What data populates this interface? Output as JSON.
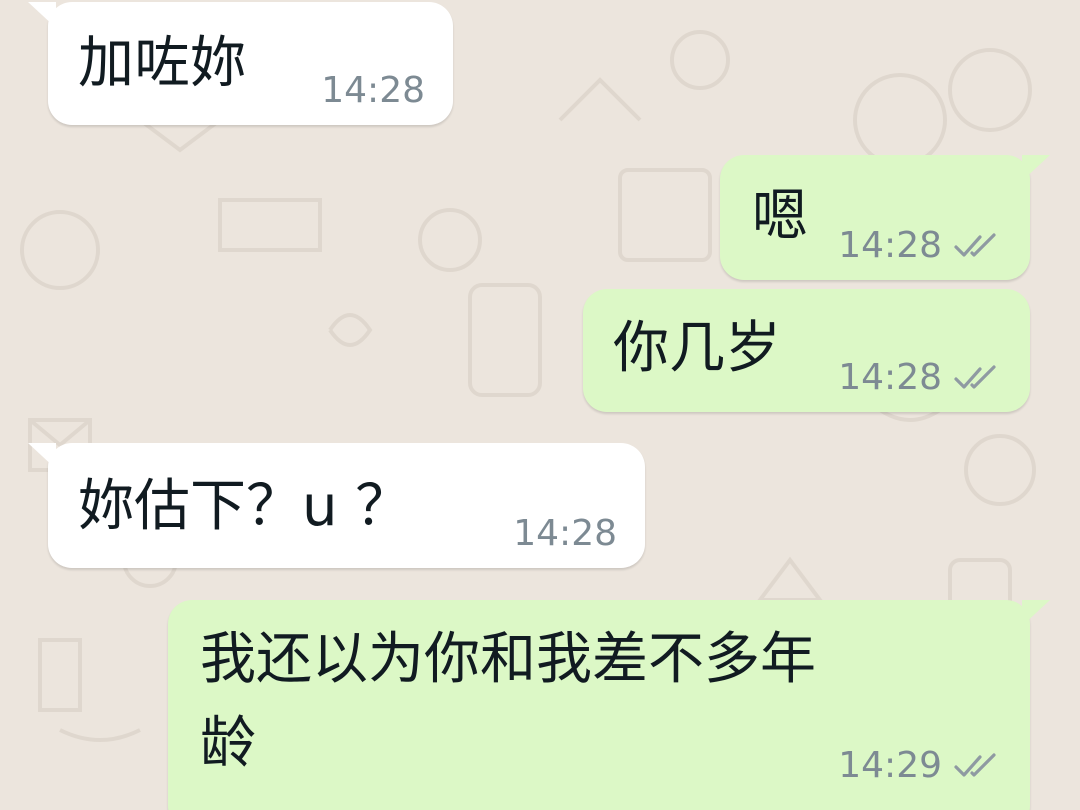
{
  "colors": {
    "wallpaper": "#ece5dd",
    "incoming_bubble": "#ffffff",
    "outgoing_bubble": "#dcf8c6",
    "timestamp": "#7d8a93",
    "read_ticks": "#8f9aa2"
  },
  "messages": [
    {
      "direction": "incoming",
      "text": "加咗妳",
      "time": "14:28"
    },
    {
      "direction": "outgoing",
      "text": "嗯",
      "time": "14:28",
      "status_icon": "double-check-icon"
    },
    {
      "direction": "outgoing",
      "text": "你几岁",
      "time": "14:28",
      "status_icon": "double-check-icon"
    },
    {
      "direction": "incoming",
      "text": "妳估下？u ？",
      "time": "14:28"
    },
    {
      "direction": "outgoing",
      "text_line1": "我还以为你和我差不多年",
      "text_line2": "龄",
      "time": "14:29",
      "status_icon": "double-check-icon"
    }
  ]
}
